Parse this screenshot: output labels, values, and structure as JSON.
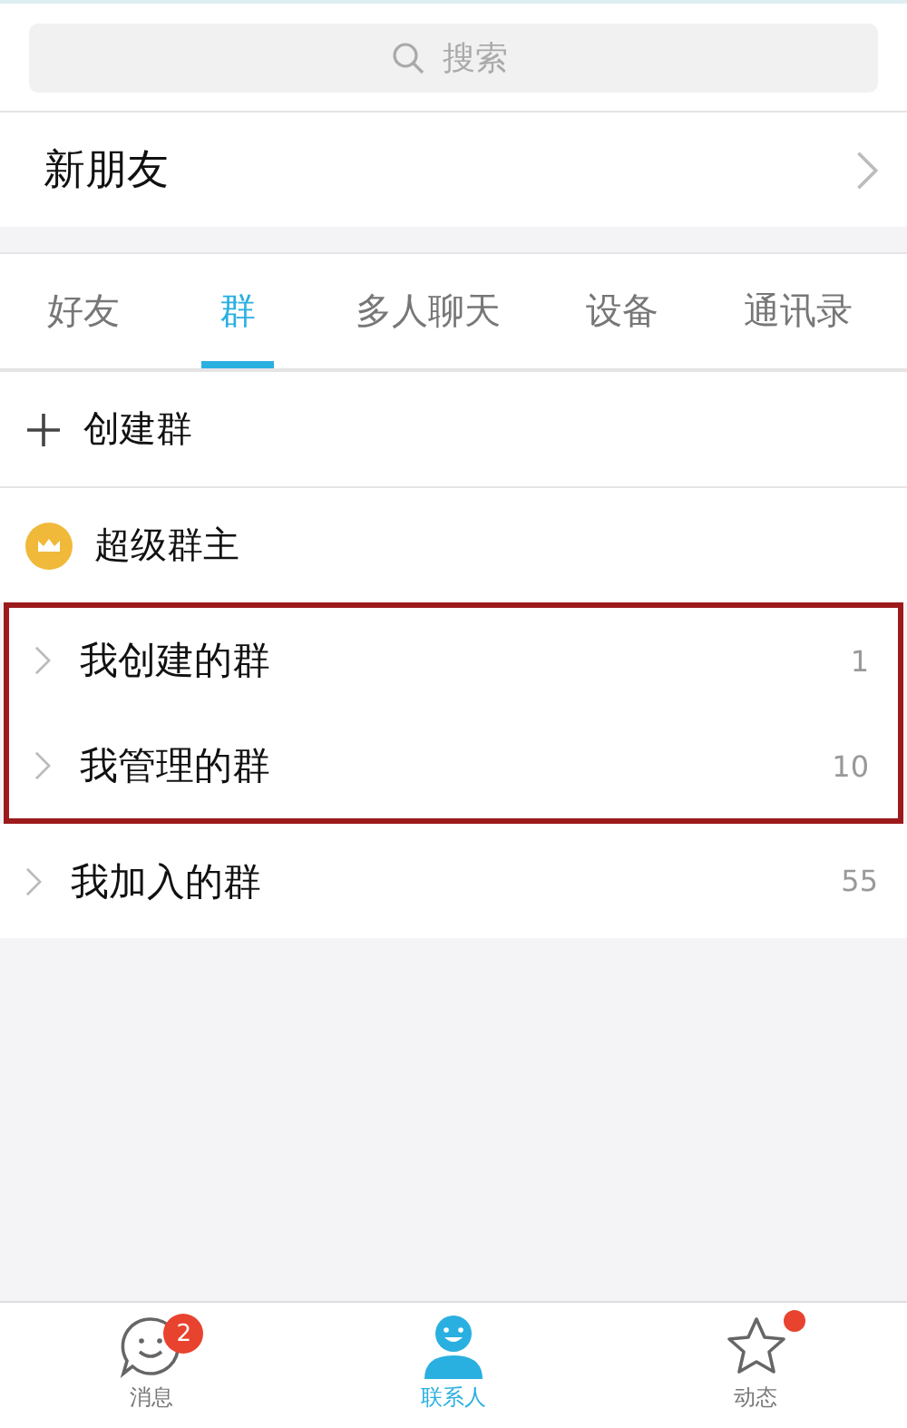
{
  "search": {
    "placeholder": "搜索"
  },
  "new_friends": {
    "label": "新朋友"
  },
  "tabs": [
    {
      "label": "好友",
      "selected": false
    },
    {
      "label": "群",
      "selected": true
    },
    {
      "label": "多人聊天",
      "selected": false
    },
    {
      "label": "设备",
      "selected": false
    },
    {
      "label": "通讯录",
      "selected": false
    }
  ],
  "actions": [
    {
      "kind": "create",
      "label": "创建群"
    },
    {
      "kind": "crown",
      "label": "超级群主"
    }
  ],
  "groups": [
    {
      "label": "我创建的群",
      "count": "1",
      "highlighted": true
    },
    {
      "label": "我管理的群",
      "count": "10",
      "highlighted": true
    },
    {
      "label": "我加入的群",
      "count": "55",
      "highlighted": false
    }
  ],
  "nav": [
    {
      "kind": "chat",
      "label": "消息",
      "selected": false,
      "badge": "2",
      "dot": false
    },
    {
      "kind": "contacts",
      "label": "联系人",
      "selected": true,
      "dot": false
    },
    {
      "kind": "star",
      "label": "动态",
      "selected": false,
      "dot": true
    }
  ]
}
